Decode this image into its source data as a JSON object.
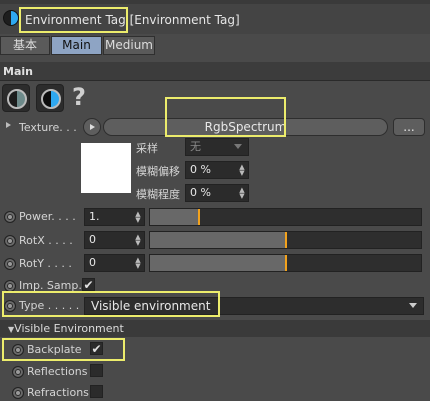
{
  "title": "Environment Tag [Environment Tag]",
  "tabs": [
    "基本",
    "Main",
    "Medium"
  ],
  "section_main": "Main",
  "texture": {
    "label": "Texture. . .",
    "value": "RgbSpectrum",
    "browse": "...",
    "sampling_label": "采样",
    "sampling_value": "无",
    "blur_offset_label": "模糊偏移",
    "blur_offset_value": "0 %",
    "blur_degree_label": "模糊程度",
    "blur_degree_value": "0 %"
  },
  "power": {
    "label": "Power. . . .",
    "value": "1.",
    "slider": 0.18
  },
  "rotx": {
    "label": "RotX . . . .",
    "value": "0",
    "slider": 0.5
  },
  "roty": {
    "label": "RotY . . . .",
    "value": "0",
    "slider": 0.5
  },
  "imp_samp": {
    "label": "Imp. Samp.",
    "checked": "✔"
  },
  "type": {
    "label": "Type . . . . .",
    "value": "Visible environment"
  },
  "visible_env": "Visible Environment",
  "backplate": {
    "label": "Backplate",
    "checked": "✔"
  },
  "reflections": {
    "label": "Reflections"
  },
  "refractions": {
    "label": "Refractions"
  },
  "help_glyph": "?",
  "accent": "#f2a21d",
  "highlight_color": "#ecec6c"
}
